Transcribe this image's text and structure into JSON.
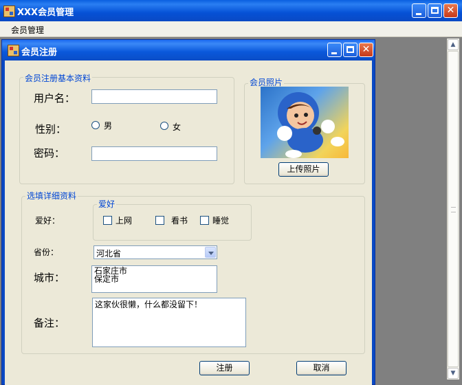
{
  "app": {
    "title": "XXX会员管理",
    "menu": [
      "会员管理"
    ]
  },
  "dialog": {
    "title": "会员注册",
    "basic_group": {
      "legend": "会员注册基本资料",
      "username_label": "用户名：",
      "username_value": "",
      "gender_label": "性别：",
      "gender_options": [
        "男",
        "女"
      ],
      "password_label": "密码：",
      "password_value": ""
    },
    "photo_group": {
      "legend": "会员照片",
      "upload_button": "上传照片"
    },
    "detail_group": {
      "legend": "选填详细资料",
      "hobby_label": "爱好：",
      "hobby_group_legend": "爱好",
      "hobbies": [
        "上网",
        "看书",
        "睡觉"
      ],
      "province_label": "省份：",
      "province_value": "河北省",
      "city_label": "城市：",
      "cities": [
        "石家庄市",
        "保定市"
      ],
      "remark_label": "备注：",
      "remark_value": "这家伙很懒，什么都没留下！"
    },
    "buttons": {
      "register": "注册",
      "cancel": "取消"
    }
  },
  "colors": {
    "titlebar": "#0a5fe0",
    "legend_text": "#0046d5",
    "client_bg": "#ece9d8",
    "mdi_bg": "#808080"
  }
}
